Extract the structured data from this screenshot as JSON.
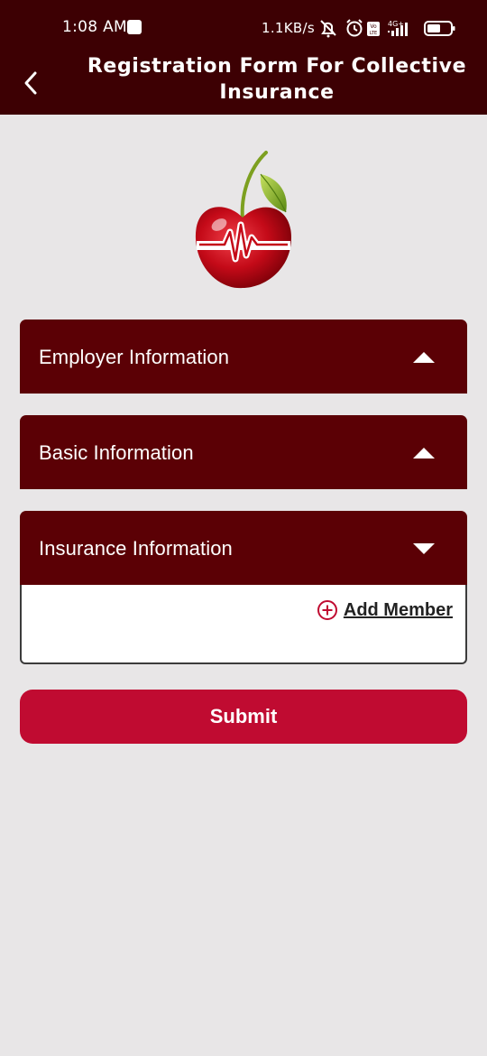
{
  "status_bar": {
    "time": "1:08 AM",
    "network_speed": "1.1KB/s",
    "icons": [
      "notifications-off-icon",
      "alarm-icon",
      "volte-icon",
      "4g-signal-icon",
      "battery-icon"
    ]
  },
  "header": {
    "back_icon": "chevron-left-icon",
    "title": "Registration Form For Collective Insurance"
  },
  "logo": {
    "icon": "cherry-heartbeat-logo"
  },
  "sections": [
    {
      "label": "Employer Information",
      "state": "collapsed",
      "arrow": "caret-up-icon"
    },
    {
      "label": "Basic Information",
      "state": "collapsed",
      "arrow": "caret-up-icon"
    },
    {
      "label": "Insurance Information",
      "state": "expanded",
      "arrow": "caret-down-icon"
    }
  ],
  "insurance": {
    "add_member_label": "Add Member",
    "add_member_icon": "plus-circle-icon"
  },
  "submit": {
    "label": "Submit"
  },
  "colors": {
    "header_bg": "#3d0003",
    "section_bg": "#5b0005",
    "accent": "#c00b31",
    "page_bg": "#e8e6e7"
  }
}
